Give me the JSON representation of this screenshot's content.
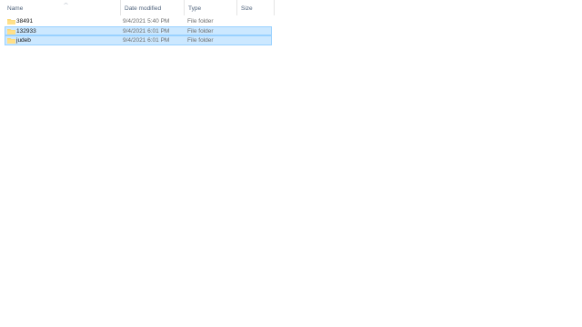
{
  "columns": {
    "name": "Name",
    "date_modified": "Date modified",
    "type": "Type",
    "size": "Size"
  },
  "sort": {
    "column": "Name",
    "direction": "ascending"
  },
  "files": [
    {
      "name": "38491",
      "date_modified": "9/4/2021 5:40 PM",
      "type": "File folder",
      "size": "",
      "selected": false,
      "icon": "folder-icon"
    },
    {
      "name": "132933",
      "date_modified": "9/4/2021 6:01 PM",
      "type": "File folder",
      "size": "",
      "selected": true,
      "icon": "folder-icon"
    },
    {
      "name": "judeb",
      "date_modified": "9/4/2021 6:01 PM",
      "type": "File folder",
      "size": "",
      "selected": true,
      "icon": "folder-icon"
    }
  ],
  "colors": {
    "selection_background": "#cce8ff",
    "selection_border": "#99d1ff",
    "folder": "#f8d775",
    "header_text": "#4c607a"
  }
}
